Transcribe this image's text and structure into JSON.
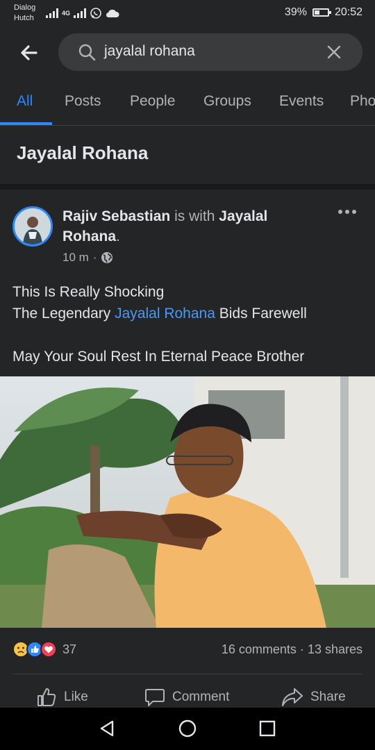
{
  "status_bar": {
    "carrier_line1": "Dialog",
    "carrier_line2": "Hutch",
    "network_type": "4G",
    "battery_percent": "39%",
    "battery_level": 0.39,
    "time": "20:52",
    "icons": [
      "signal-icon",
      "whatsapp-icon",
      "cloud-icon"
    ]
  },
  "search": {
    "query": "jayalal rohana",
    "back_icon": "back-arrow-icon",
    "search_icon": "search-icon",
    "clear_icon": "close-icon"
  },
  "tabs": [
    {
      "label": "All",
      "active": true
    },
    {
      "label": "Posts",
      "active": false
    },
    {
      "label": "People",
      "active": false
    },
    {
      "label": "Groups",
      "active": false
    },
    {
      "label": "Events",
      "active": false
    },
    {
      "label": "Pho",
      "active": false
    }
  ],
  "results_title": "Jayalal Rohana",
  "post": {
    "author": "Rajiv Sebastian",
    "with_text": "is with",
    "tagged": "Jayalal Rohana",
    "period": ".",
    "time": "10 m",
    "separator": "·",
    "privacy_icon": "globe-icon",
    "more_icon": "more-options-icon",
    "text_line1": "This Is Really Shocking",
    "text_line2_prefix": "The Legendary",
    "text_line2_link": "Jayalal Rohana",
    "text_line2_suffix": "Bids Farewell",
    "text_line3": "May Your Soul Rest In Eternal Peace Brother",
    "reaction_icons": [
      "sad-reaction-icon",
      "like-reaction-icon",
      "love-reaction-icon"
    ],
    "reaction_count": "37",
    "comments": "16 comments",
    "dot": "·",
    "shares": "13 shares",
    "actions": {
      "like": "Like",
      "comment": "Comment",
      "share": "Share"
    }
  },
  "colors": {
    "background": "#18191a",
    "surface": "#242526",
    "accent": "#2d88ff",
    "link": "#4599ff",
    "text": "#e4e6eb",
    "muted": "#b0b3b8"
  },
  "nav_bar": {
    "buttons": [
      "back-triangle-icon",
      "home-circle-icon",
      "recents-square-icon"
    ]
  }
}
